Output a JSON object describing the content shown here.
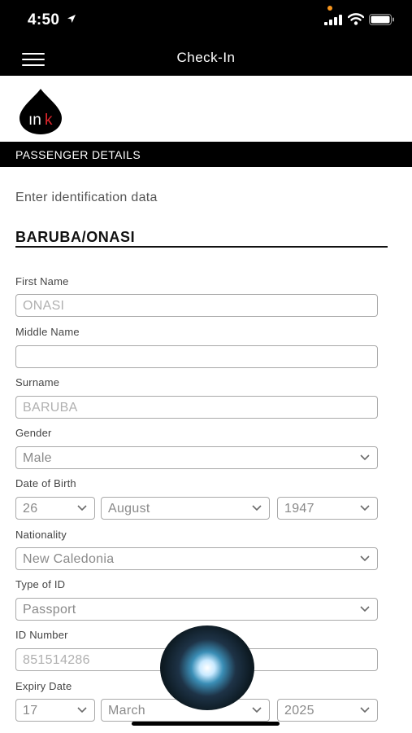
{
  "status_bar": {
    "time": "4:50"
  },
  "nav": {
    "title": "Check-In"
  },
  "brand": {
    "logo_text": "ınk",
    "accent_color": "#e0262c"
  },
  "section": {
    "title": "PASSENGER DETAILS"
  },
  "intro": "Enter identification data",
  "passenger": {
    "name": "BARUBA/ONASI"
  },
  "fields": {
    "first_name": {
      "label": "First Name",
      "value": "ONASI"
    },
    "middle_name": {
      "label": "Middle Name",
      "value": ""
    },
    "surname": {
      "label": "Surname",
      "value": "BARUBA"
    },
    "gender": {
      "label": "Gender",
      "value": "Male"
    },
    "dob": {
      "label": "Date of Birth",
      "day": "26",
      "month": "August",
      "year": "1947"
    },
    "nationality": {
      "label": "Nationality",
      "value": "New Caledonia"
    },
    "id_type": {
      "label": "Type of ID",
      "value": "Passport"
    },
    "id_number": {
      "label": "ID Number",
      "value": "851514286"
    },
    "expiry": {
      "label": "Expiry Date",
      "day": "17",
      "month": "March",
      "year": "2025"
    }
  }
}
